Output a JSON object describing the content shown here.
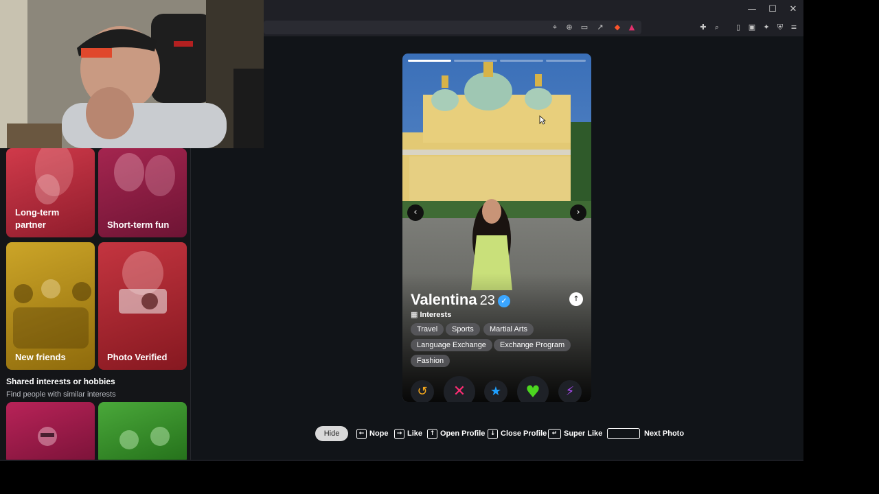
{
  "window": {
    "minimize_label": "—",
    "maximize_label": "☐",
    "close_label": "✕"
  },
  "sidebar": {
    "tiles": [
      {
        "label": "Long-term partner",
        "color": "#b0283a"
      },
      {
        "label": "Short-term fun",
        "color": "#8c1e42"
      },
      {
        "label": "New friends",
        "color": "#b89216"
      },
      {
        "label": "Photo Verified",
        "color": "#b52a33"
      },
      {
        "label": "",
        "color": "#9c1d4a"
      },
      {
        "label": "",
        "color": "#3a8a2d"
      }
    ],
    "section_title": "Shared interests or hobbies",
    "section_subtitle": "Find people with similar interests"
  },
  "profile": {
    "name": "Valentina",
    "age": "23",
    "verified_mark": "✓",
    "interests_label": "Interests",
    "interests": [
      "Travel",
      "Sports",
      "Martial Arts",
      "Language Exchange",
      "Exchange Program",
      "Fashion"
    ],
    "photo_count": 4,
    "active_photo_index": 1
  },
  "actions": {
    "rewind_icon": "↺",
    "nope_icon": "✕",
    "superlike_icon": "★",
    "like_icon": "♥",
    "boost_icon": "⚡"
  },
  "shortcuts": {
    "hide_label": "Hide",
    "nope_label": "Nope",
    "like_label": "Like",
    "open_profile_label": "Open Profile",
    "close_profile_label": "Close Profile",
    "super_like_label": "Super Like",
    "next_photo_label": "Next Photo",
    "nope_key": "←",
    "like_key": "→",
    "open_key": "↑",
    "close_key": "↓",
    "super_key": "↵"
  },
  "colors": {
    "accent_like": "#4cd620",
    "accent_nope": "#ff2d74",
    "accent_super": "#1fa0ff",
    "accent_rewind": "#f6a81c",
    "accent_boost": "#b24dff"
  }
}
